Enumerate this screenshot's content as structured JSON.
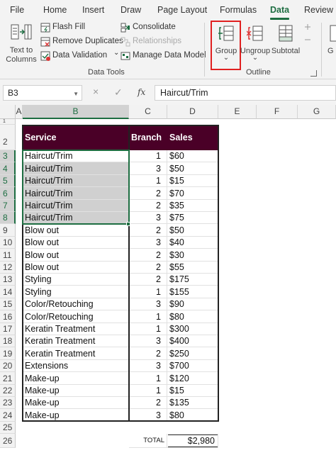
{
  "tabs": [
    {
      "label": "File",
      "active": false
    },
    {
      "label": "Home",
      "active": false
    },
    {
      "label": "Insert",
      "active": false
    },
    {
      "label": "Draw",
      "active": false
    },
    {
      "label": "Page Layout",
      "active": false
    },
    {
      "label": "Formulas",
      "active": false
    },
    {
      "label": "Data",
      "active": true
    },
    {
      "label": "Review",
      "active": false
    }
  ],
  "ribbon": {
    "text_to_columns_line1": "Text to",
    "text_to_columns_line2": "Columns",
    "flash_fill": "Flash Fill",
    "remove_duplicates": "Remove Duplicates",
    "data_validation": "Data Validation",
    "data_validation_caret": "⌄",
    "consolidate": "Consolidate",
    "relationships": "Relationships",
    "manage_data_model": "Manage Data Model",
    "data_tools_group": "Data Tools",
    "group": "Group",
    "group_caret": "⌄",
    "ungroup": "Ungroup",
    "ungroup_caret": "⌄",
    "subtotal": "Subtotal",
    "outline_group": "Outline",
    "truncated_button": "G"
  },
  "formula_bar": {
    "name_box": "B3",
    "cancel_icon": "×",
    "enter_icon": "✓",
    "fx_label": "fx",
    "content": "Haircut/Trim"
  },
  "sheet": {
    "columns": [
      "A",
      "B",
      "C",
      "D",
      "E",
      "F",
      "G"
    ],
    "header_row": {
      "service": "Service",
      "branch": "Branch",
      "sales": "Sales"
    },
    "rows": [
      {
        "row": "3",
        "service": "Haircut/Trim",
        "branch": "1",
        "sales": "$60"
      },
      {
        "row": "4",
        "service": "Haircut/Trim",
        "branch": "3",
        "sales": "$50"
      },
      {
        "row": "5",
        "service": "Haircut/Trim",
        "branch": "1",
        "sales": "$15"
      },
      {
        "row": "6",
        "service": "Haircut/Trim",
        "branch": "2",
        "sales": "$70"
      },
      {
        "row": "7",
        "service": "Haircut/Trim",
        "branch": "2",
        "sales": "$35"
      },
      {
        "row": "8",
        "service": "Haircut/Trim",
        "branch": "3",
        "sales": "$75"
      },
      {
        "row": "9",
        "service": "Blow out",
        "branch": "2",
        "sales": "$50"
      },
      {
        "row": "10",
        "service": "Blow out",
        "branch": "3",
        "sales": "$40"
      },
      {
        "row": "11",
        "service": "Blow out",
        "branch": "2",
        "sales": "$30"
      },
      {
        "row": "12",
        "service": "Blow out",
        "branch": "2",
        "sales": "$55"
      },
      {
        "row": "13",
        "service": "Styling",
        "branch": "2",
        "sales": "$175"
      },
      {
        "row": "14",
        "service": "Styling",
        "branch": "1",
        "sales": "$155"
      },
      {
        "row": "15",
        "service": "Color/Retouching",
        "branch": "3",
        "sales": "$90"
      },
      {
        "row": "16",
        "service": "Color/Retouching",
        "branch": "1",
        "sales": "$80"
      },
      {
        "row": "17",
        "service": "Keratin Treatment",
        "branch": "1",
        "sales": "$300"
      },
      {
        "row": "18",
        "service": "Keratin Treatment",
        "branch": "3",
        "sales": "$400"
      },
      {
        "row": "19",
        "service": "Keratin Treatment",
        "branch": "2",
        "sales": "$250"
      },
      {
        "row": "20",
        "service": "Extensions",
        "branch": "3",
        "sales": "$700"
      },
      {
        "row": "21",
        "service": "Make-up",
        "branch": "1",
        "sales": "$120"
      },
      {
        "row": "22",
        "service": "Make-up",
        "branch": "1",
        "sales": "$15"
      },
      {
        "row": "23",
        "service": "Make-up",
        "branch": "2",
        "sales": "$135"
      },
      {
        "row": "24",
        "service": "Make-up",
        "branch": "3",
        "sales": "$80"
      }
    ],
    "row_1": "1",
    "row_2": "2",
    "row_25": "25",
    "row_26": "26",
    "total_label": "TOTAL",
    "total_value": "$2,980",
    "colors": {
      "header_fill": "#4a0027",
      "accent": "#1e6e42",
      "highlight": "#e02020"
    }
  }
}
